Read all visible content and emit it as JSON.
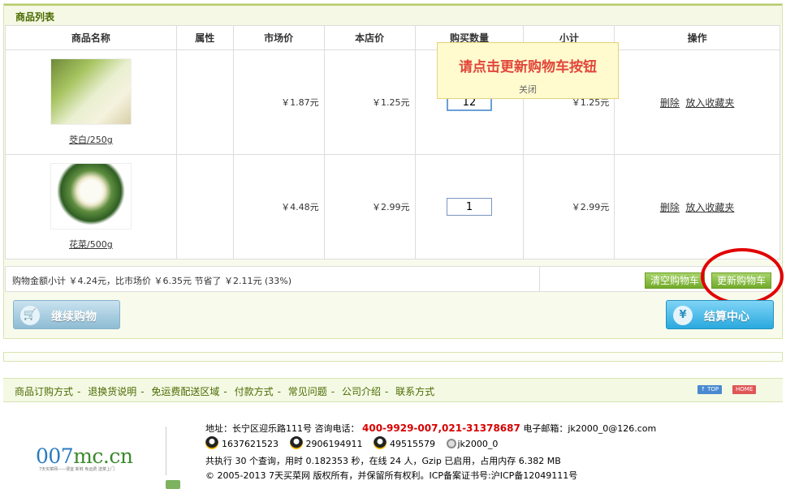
{
  "cart": {
    "title": "商品列表",
    "columns": [
      "商品名称",
      "属性",
      "市场价",
      "本店价",
      "购买数量",
      "小计",
      "操作"
    ],
    "items": [
      {
        "name": "茭白/250g",
        "attr": "",
        "market_price": "￥1.87元",
        "shop_price": "￥1.25元",
        "qty": "12",
        "subtotal": "￥1.25元",
        "op_delete": "删除",
        "op_fav": "放入收藏夹"
      },
      {
        "name": "花菜/500g",
        "attr": "",
        "market_price": "￥4.48元",
        "shop_price": "￥2.99元",
        "qty": "1",
        "subtotal": "￥2.99元",
        "op_delete": "删除",
        "op_fav": "放入收藏夹"
      }
    ],
    "summary": "购物金额小计 ￥4.24元，比市场价 ￥6.35元 节省了 ￥2.11元 (33%)",
    "clear_label": "清空购物车",
    "update_label": "更新购物车",
    "continue_label": "继续购物",
    "checkout_label": "结算中心",
    "continue_icon": "cart-icon",
    "checkout_icon": "yen-icon"
  },
  "popup": {
    "message": "请点击更新购物车按钮",
    "close": "关闭"
  },
  "footer": {
    "nav": [
      "商品订购方式",
      "退换货说明",
      "免运费配送区域",
      "付款方式",
      "常见问题",
      "公司介绍",
      "联系方式"
    ],
    "top_tag": "↑ TOP",
    "home_tag": "HOME",
    "logo_main": "007",
    "logo_rest": "mc.cn",
    "logo_sub": "7天买菜网——便宜 新鲜 免运费 送菜上门",
    "address_prefix": "地址：长宁区迎乐路111号 咨询电话：",
    "phone": "400-9929-007,021-31378687",
    "email": "电子邮箱：jk2000_0@126.com",
    "qq": [
      "1637621523",
      "2906194911",
      "49515579"
    ],
    "wangwang": "jk2000_0",
    "stats": "共执行 30 个查询，用时 0.182353 秒，在线 24 人，Gzip 已启用，占用内存 6.382 MB",
    "copyright": "© 2005-2013 7天买菜网 版权所有，并保留所有权利。ICP备案证书号:沪ICP备12049111号"
  },
  "colors": {
    "accent_green": "#72aa2a",
    "popup_text": "#e2463a",
    "phone_red": "#d60000",
    "circle_red": "#e20000"
  }
}
